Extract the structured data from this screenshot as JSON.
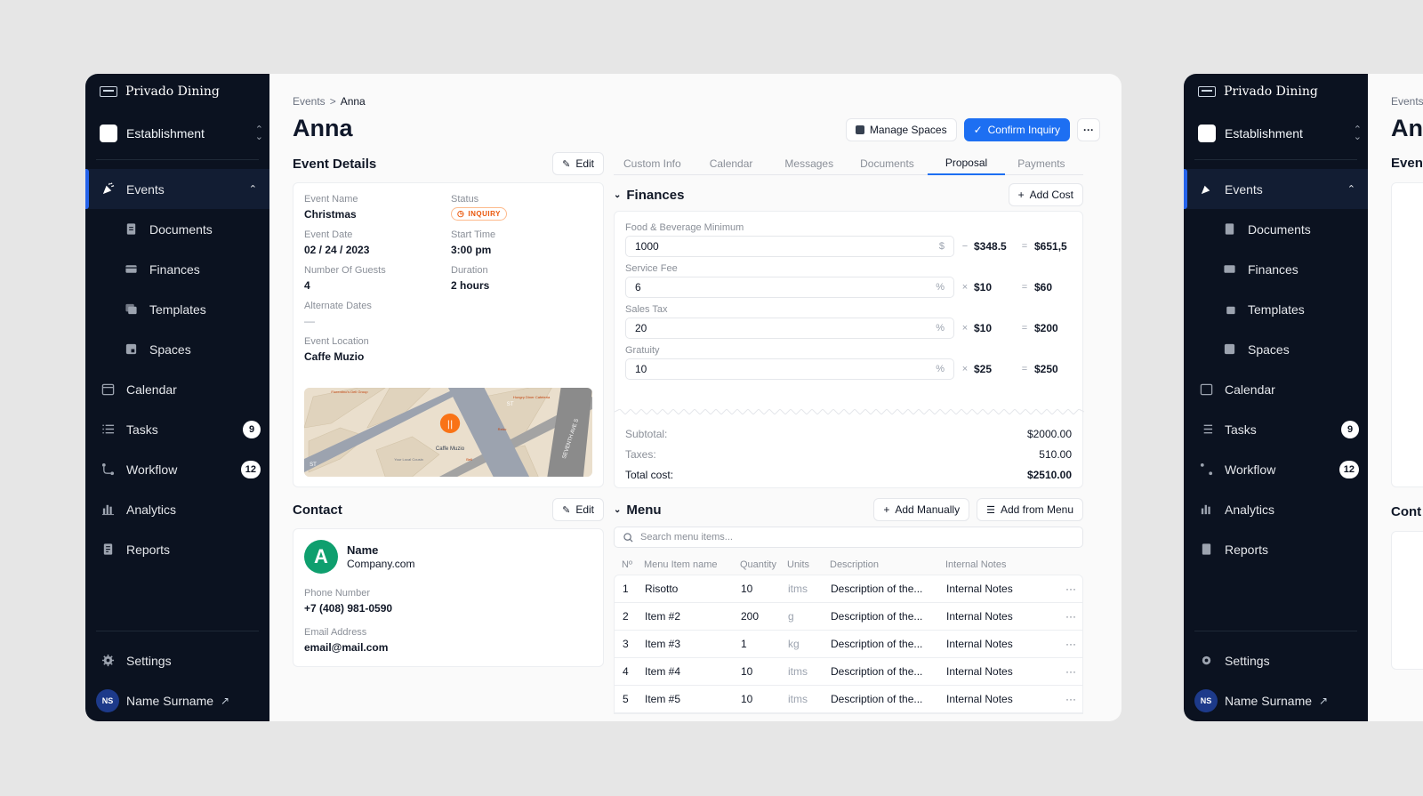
{
  "brand": {
    "name": "Privado Dining"
  },
  "sidebar": {
    "establishment": "Establishment",
    "items": [
      {
        "label": "Events",
        "icon": "party-popper-icon"
      },
      {
        "label": "Documents",
        "icon": "document-icon"
      },
      {
        "label": "Finances",
        "icon": "credit-card-icon"
      },
      {
        "label": "Templates",
        "icon": "templates-icon"
      },
      {
        "label": "Spaces",
        "icon": "spaces-icon"
      },
      {
        "label": "Calendar",
        "icon": "calendar-icon"
      },
      {
        "label": "Tasks",
        "icon": "list-icon",
        "badge": "9"
      },
      {
        "label": "Workflow",
        "icon": "workflow-icon",
        "badge": "12"
      },
      {
        "label": "Analytics",
        "icon": "analytics-icon"
      },
      {
        "label": "Reports",
        "icon": "reports-icon"
      }
    ],
    "settings": "Settings",
    "user": {
      "initials": "NS",
      "name": "Name Surname"
    }
  },
  "breadcrumb": {
    "parent": "Events",
    "sep": ">",
    "current": "Anna"
  },
  "page_title": "Anna",
  "actions": {
    "manage_spaces": "Manage Spaces",
    "confirm_inquiry": "Confirm Inquiry",
    "more": "···"
  },
  "event_details": {
    "title": "Event Details",
    "edit": "Edit",
    "event_name_label": "Event Name",
    "event_name": "Christmas",
    "status_label": "Status",
    "status": "INQUIRY",
    "event_date_label": "Event Date",
    "event_date": "02 / 24 / 2023",
    "start_time_label": "Start Time",
    "start_time": "3:00 pm",
    "guests_label": "Number Of Guests",
    "guests": "4",
    "duration_label": "Duration",
    "duration": "2 hours",
    "alt_dates_label": "Alternate Dates",
    "alt_dates": "—",
    "location_label": "Event Location",
    "location": "Caffe Muzio",
    "map": {
      "pin_label": "Caffe Muzio",
      "street": "SEVENTH AVE S",
      "st1": "ST",
      "st2": "ST",
      "poi1": "Fiorentino's Deli Group",
      "poi2": "Your Local Cousin",
      "poi3": "Hungry Diner Cafeteria",
      "poi4": "Rebo",
      "poi5": "Bell"
    }
  },
  "contact": {
    "title": "Contact",
    "edit": "Edit",
    "avatar": "A",
    "name": "Name",
    "company": "Company.com",
    "phone_label": "Phone Number",
    "phone": "+7 (408) 981-0590",
    "email_label": "Email Address",
    "email": "email@mail.com"
  },
  "tabs": [
    "Custom Info",
    "Calendar",
    "Messages",
    "Documents",
    "Proposal",
    "Payments"
  ],
  "finances": {
    "title": "Finances",
    "add_cost": "Add Cost",
    "rows": [
      {
        "label": "Food & Beverage Minimum",
        "value": "1000",
        "unit": "$",
        "op": "−",
        "mid": "$348.5",
        "eq": "=",
        "result": "$651,5"
      },
      {
        "label": "Service Fee",
        "value": "6",
        "unit": "%",
        "op": "×",
        "mid": "$10",
        "eq": "=",
        "result": "$60"
      },
      {
        "label": "Sales Tax",
        "value": "20",
        "unit": "%",
        "op": "×",
        "mid": "$10",
        "eq": "=",
        "result": "$200"
      },
      {
        "label": "Gratuity",
        "value": "10",
        "unit": "%",
        "op": "×",
        "mid": "$25",
        "eq": "=",
        "result": "$250"
      }
    ],
    "subtotal_label": "Subtotal:",
    "subtotal": "$2000.00",
    "taxes_label": "Taxes:",
    "taxes": "510.00",
    "total_label": "Total cost:",
    "total": "$2510.00"
  },
  "menu": {
    "title": "Menu",
    "add_manually": "Add Manually",
    "add_from_menu": "Add from Menu",
    "search_placeholder": "Search menu items...",
    "columns": [
      "Nº",
      "Menu Item name",
      "Quantity",
      "Units",
      "Description",
      "Internal Notes"
    ],
    "rows": [
      {
        "n": "1",
        "name": "Risotto",
        "qty": "10",
        "unit": "itms",
        "desc": "Description of the...",
        "notes": "Internal Notes"
      },
      {
        "n": "2",
        "name": "Item #2",
        "qty": "200",
        "unit": "g",
        "desc": "Description of the...",
        "notes": "Internal Notes"
      },
      {
        "n": "3",
        "name": "Item #3",
        "qty": "1",
        "unit": "kg",
        "desc": "Description of the...",
        "notes": "Internal Notes"
      },
      {
        "n": "4",
        "name": "Item #4",
        "qty": "10",
        "unit": "itms",
        "desc": "Description of the...",
        "notes": "Internal Notes"
      },
      {
        "n": "5",
        "name": "Item #5",
        "qty": "10",
        "unit": "itms",
        "desc": "Description of the...",
        "notes": "Internal Notes"
      }
    ]
  },
  "ghost": {
    "crumb": "Events",
    "title": "An",
    "section": "Event",
    "section2": "Cont"
  },
  "colors": {
    "sidebar_bg": "#0b1220",
    "accent": "#1d6ff2",
    "status": "#ea580c",
    "contact_avatar": "#0f9f6e"
  }
}
